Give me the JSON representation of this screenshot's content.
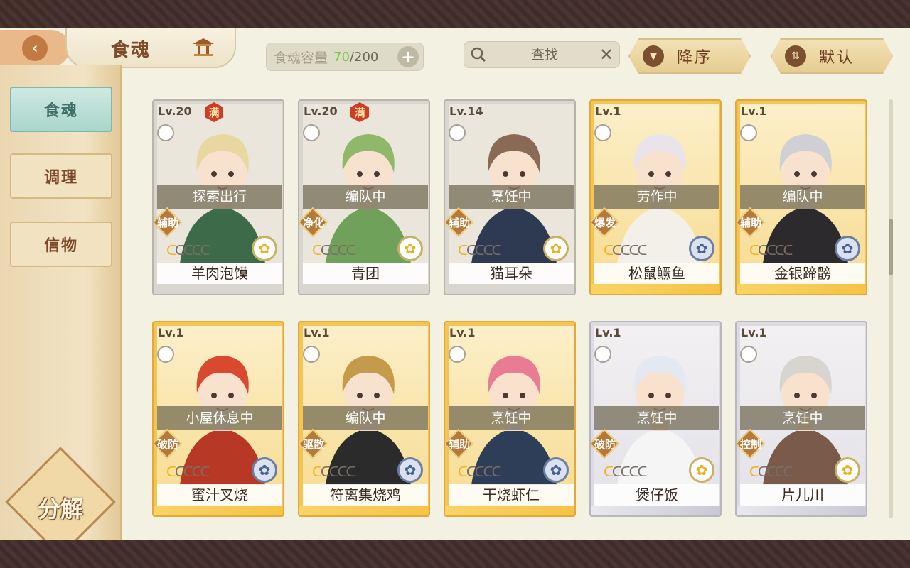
{
  "header": {
    "title": "食魂",
    "capacity_label": "食魂容量",
    "capacity_current": "70",
    "capacity_max": "200",
    "capacity_separator": "/",
    "add_label": "+",
    "search_placeholder": "查找",
    "clear_label": "✕",
    "sort_desc_label": "降序",
    "sort_default_label": "默认"
  },
  "sidebar": {
    "items": [
      {
        "label": "食魂",
        "active": true
      },
      {
        "label": "调理",
        "active": false
      },
      {
        "label": "信物",
        "active": false
      }
    ],
    "decompose_label": "分解"
  },
  "cards": [
    {
      "level": "Lv.20",
      "full": "满",
      "status": "探索出行",
      "role": "辅助",
      "name": "羊肉泡馍",
      "stars": 1,
      "rarity": "gold",
      "frame": "plain"
    },
    {
      "level": "Lv.20",
      "full": "满",
      "status": "编队中",
      "role": "净化",
      "name": "青团",
      "stars": 1,
      "rarity": "gold",
      "frame": "plain"
    },
    {
      "level": "Lv.14",
      "full": "",
      "status": "烹饪中",
      "role": "辅助",
      "name": "猫耳朵",
      "stars": 1,
      "rarity": "gold",
      "frame": "plain"
    },
    {
      "level": "Lv.1",
      "full": "",
      "status": "劳作中",
      "role": "爆发",
      "name": "松鼠鳜鱼",
      "stars": 1,
      "rarity": "blue",
      "frame": "gold"
    },
    {
      "level": "Lv.1",
      "full": "",
      "status": "编队中",
      "role": "辅助",
      "name": "金银蹄髈",
      "stars": 1,
      "rarity": "blue",
      "frame": "gold"
    },
    {
      "level": "Lv.1",
      "full": "",
      "status": "小屋休息中",
      "role": "破防",
      "name": "蜜汁叉烧",
      "stars": 1,
      "rarity": "blue",
      "frame": "gold"
    },
    {
      "level": "Lv.1",
      "full": "",
      "status": "编队中",
      "role": "驱散",
      "name": "符离集烧鸡",
      "stars": 1,
      "rarity": "blue",
      "frame": "gold"
    },
    {
      "level": "Lv.1",
      "full": "",
      "status": "烹饪中",
      "role": "辅助",
      "name": "干烧虾仁",
      "stars": 1,
      "rarity": "blue",
      "frame": "gold"
    },
    {
      "level": "Lv.1",
      "full": "",
      "status": "烹饪中",
      "role": "破防",
      "name": "煲仔饭",
      "stars": 1,
      "rarity": "gold",
      "frame": "silver"
    },
    {
      "level": "Lv.1",
      "full": "",
      "status": "烹饪中",
      "role": "控制",
      "name": "片儿川",
      "stars": 1,
      "rarity": "gold",
      "frame": "silver"
    }
  ],
  "scroll_position": 0.3
}
